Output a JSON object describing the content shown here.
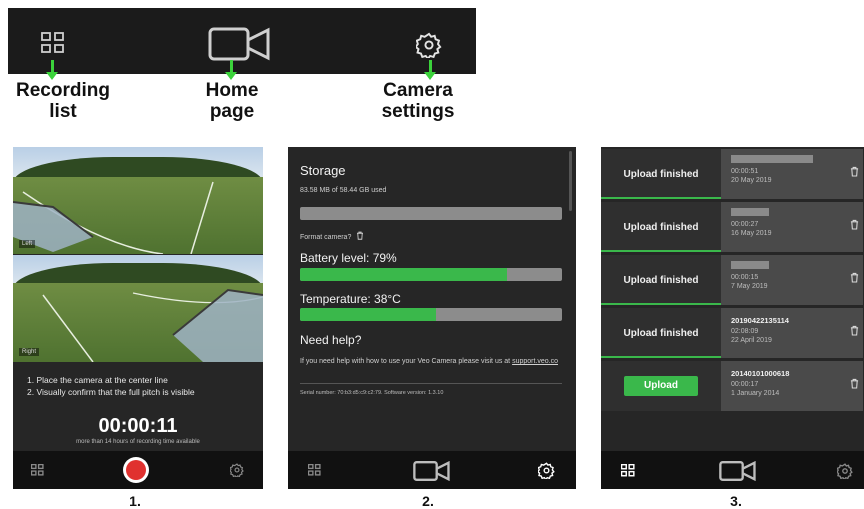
{
  "legend": {
    "recording_list": "Recording\nlist",
    "home_page": "Home\npage",
    "camera_settings": "Camera\nsettings"
  },
  "icons": {
    "recording_list": "grid-icon",
    "home_page": "video-camera-icon",
    "camera_settings": "gear-icon",
    "trash": "trash-icon",
    "record": "record-button"
  },
  "colors": {
    "accent_green": "#3ab84b",
    "record_red": "#e0312f"
  },
  "screen1": {
    "caption": "1.",
    "cam_left_tag": "Left",
    "cam_right_tag": "Right",
    "instruction_1": "1. Place the camera at the center line",
    "instruction_2": "2. Visually confirm that the full pitch is visible",
    "timer": "00:00:11",
    "time_available": "more than 14 hours of recording time available"
  },
  "screen2": {
    "caption": "2.",
    "storage_title": "Storage",
    "storage_used": "83.58 MB of 58.44 GB used",
    "storage_fraction": 0.0,
    "format_label": "Format camera?",
    "battery_label": "Battery level: 79%",
    "battery_fraction": 0.79,
    "temperature_label": "Temperature: 38°C",
    "temperature_fraction": 0.52,
    "help_title": "Need help?",
    "help_text": "If you need help with how to use your Veo Camera please visit us at",
    "help_link": "support.veo.co",
    "serial": "Serial number: 70:b3:d5:c9:c2:79. Software version: 1.3.10"
  },
  "screen3": {
    "caption": "3.",
    "rows": [
      {
        "status": "Upload finished",
        "name": "",
        "duration": "00:00:51",
        "date": "20 May 2019"
      },
      {
        "status": "Upload finished",
        "name": "",
        "duration": "00:00:27",
        "date": "16 May 2019"
      },
      {
        "status": "Upload finished",
        "name": "",
        "duration": "00:00:15",
        "date": "7 May 2019"
      },
      {
        "status": "Upload finished",
        "name": "20190422135114",
        "duration": "02:08:09",
        "date": "22 April 2019"
      },
      {
        "status": "Upload",
        "name": "20140101000618",
        "duration": "00:00:17",
        "date": "1 January 2014"
      }
    ]
  }
}
